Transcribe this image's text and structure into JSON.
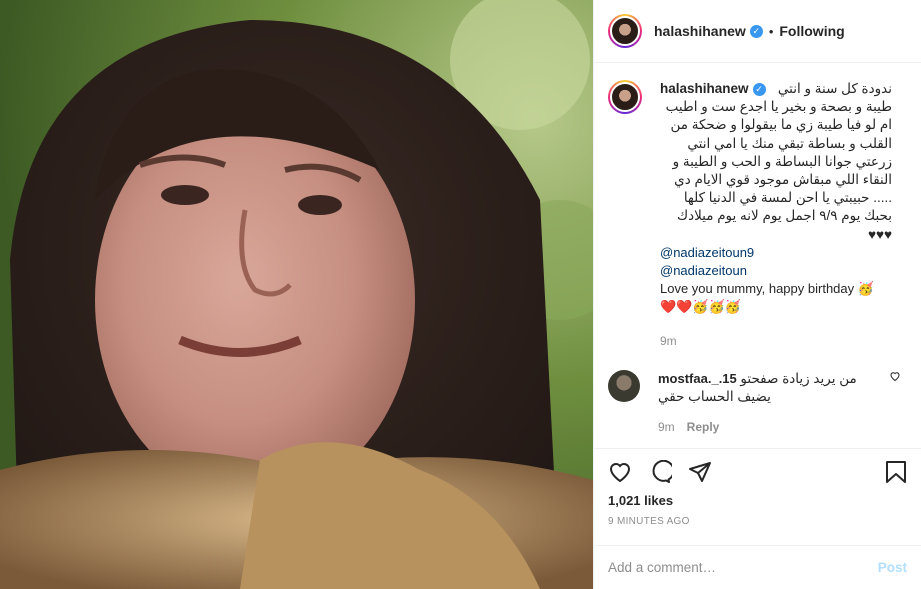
{
  "post": {
    "username": "halashihanew",
    "verified_mark": "✓",
    "dot": "•",
    "follow_status": "Following"
  },
  "caption": {
    "username": "halashihanew",
    "arabic_text": "ندودة كل سنة و انتي طيبة و بصحة و بخير يا اجدع ست و اطيب ام لو فيا طيبة زي ما بيقولوا و ضحكة من القلب و بساطة تبقي منك يا امي انتي زرعتي جوانا البساطة و الحب و الطيبة و النقاء اللي مبقاش موجود قوي الايام دي ..... حبيبتي يا احن لمسة في الدنيا كلها بحبك يوم ٩/٩ اجمل يوم لانه يوم ميلادك ♥♥♥",
    "mention_1": "@nadiazeitoun9",
    "mention_2": "@nadiazeitoun",
    "english_text": "Love you mummy, happy birthday 🥳",
    "emoji_line": "❤️❤️🥳🥳🥳",
    "time": "9m"
  },
  "comment": {
    "username": "mostfaa._.15",
    "text": "من يريد زيادة صفحتو يضيف الحساب حقي",
    "time": "9m",
    "reply_label": "Reply"
  },
  "stats": {
    "likes": "1,021 likes",
    "posted_ago": "9 MINUTES AGO"
  },
  "add_comment": {
    "placeholder": "Add a comment…",
    "post_label": "Post"
  },
  "icons": [
    "heart-icon",
    "comment-icon",
    "share-icon",
    "bookmark-icon",
    "verified-icon",
    "small-heart-icon"
  ]
}
